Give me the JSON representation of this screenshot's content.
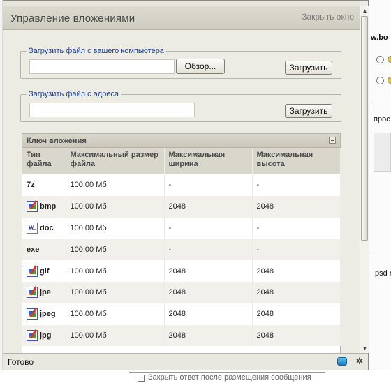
{
  "window": {
    "title": "Управление вложениями",
    "close_label": "Закрыть окно"
  },
  "upload_computer": {
    "legend": "Загрузить файл с вашего компьютера",
    "browse_label": "Обзор...",
    "upload_label": "Загрузить",
    "file_value": ""
  },
  "upload_url": {
    "legend": "Загрузить файл с адреса",
    "url_value": "",
    "upload_label": "Загрузить"
  },
  "attachment_key": {
    "title": "Ключ вложения",
    "columns": [
      "Тип файла",
      "Максимальный размер файла",
      "Максимальная ширина",
      "Максимальная высота"
    ],
    "rows": [
      {
        "ext": "7z",
        "icon": "none",
        "size": "100.00 Мб",
        "width": "-",
        "height": "-"
      },
      {
        "ext": "bmp",
        "icon": "image-file-icon",
        "size": "100.00 Мб",
        "width": "2048",
        "height": "2048"
      },
      {
        "ext": "doc",
        "icon": "word-document-icon",
        "size": "100.00 Мб",
        "width": "-",
        "height": "-"
      },
      {
        "ext": "exe",
        "icon": "none",
        "size": "100.00 Мб",
        "width": "-",
        "height": "-"
      },
      {
        "ext": "gif",
        "icon": "image-file-icon",
        "size": "100.00 Мб",
        "width": "2048",
        "height": "2048"
      },
      {
        "ext": "jpe",
        "icon": "image-file-icon",
        "size": "100.00 Мб",
        "width": "2048",
        "height": "2048"
      },
      {
        "ext": "jpeg",
        "icon": "image-file-icon",
        "size": "100.00 Мб",
        "width": "2048",
        "height": "2048"
      },
      {
        "ext": "jpg",
        "icon": "image-file-icon",
        "size": "100.00 Мб",
        "width": "2048",
        "height": "2048"
      }
    ]
  },
  "statusbar": {
    "text": "Готово"
  },
  "background": {
    "fragments": {
      "site": "w.bo",
      "search": "прос",
      "psd": "psd r",
      "bottom_checkbox": "Закрыть ответ после размещения сообщения"
    }
  },
  "colors": {
    "legend_text": "#1c3f8c",
    "header_bg": "#d9d7cc",
    "window_bg": "#ecebe4"
  }
}
